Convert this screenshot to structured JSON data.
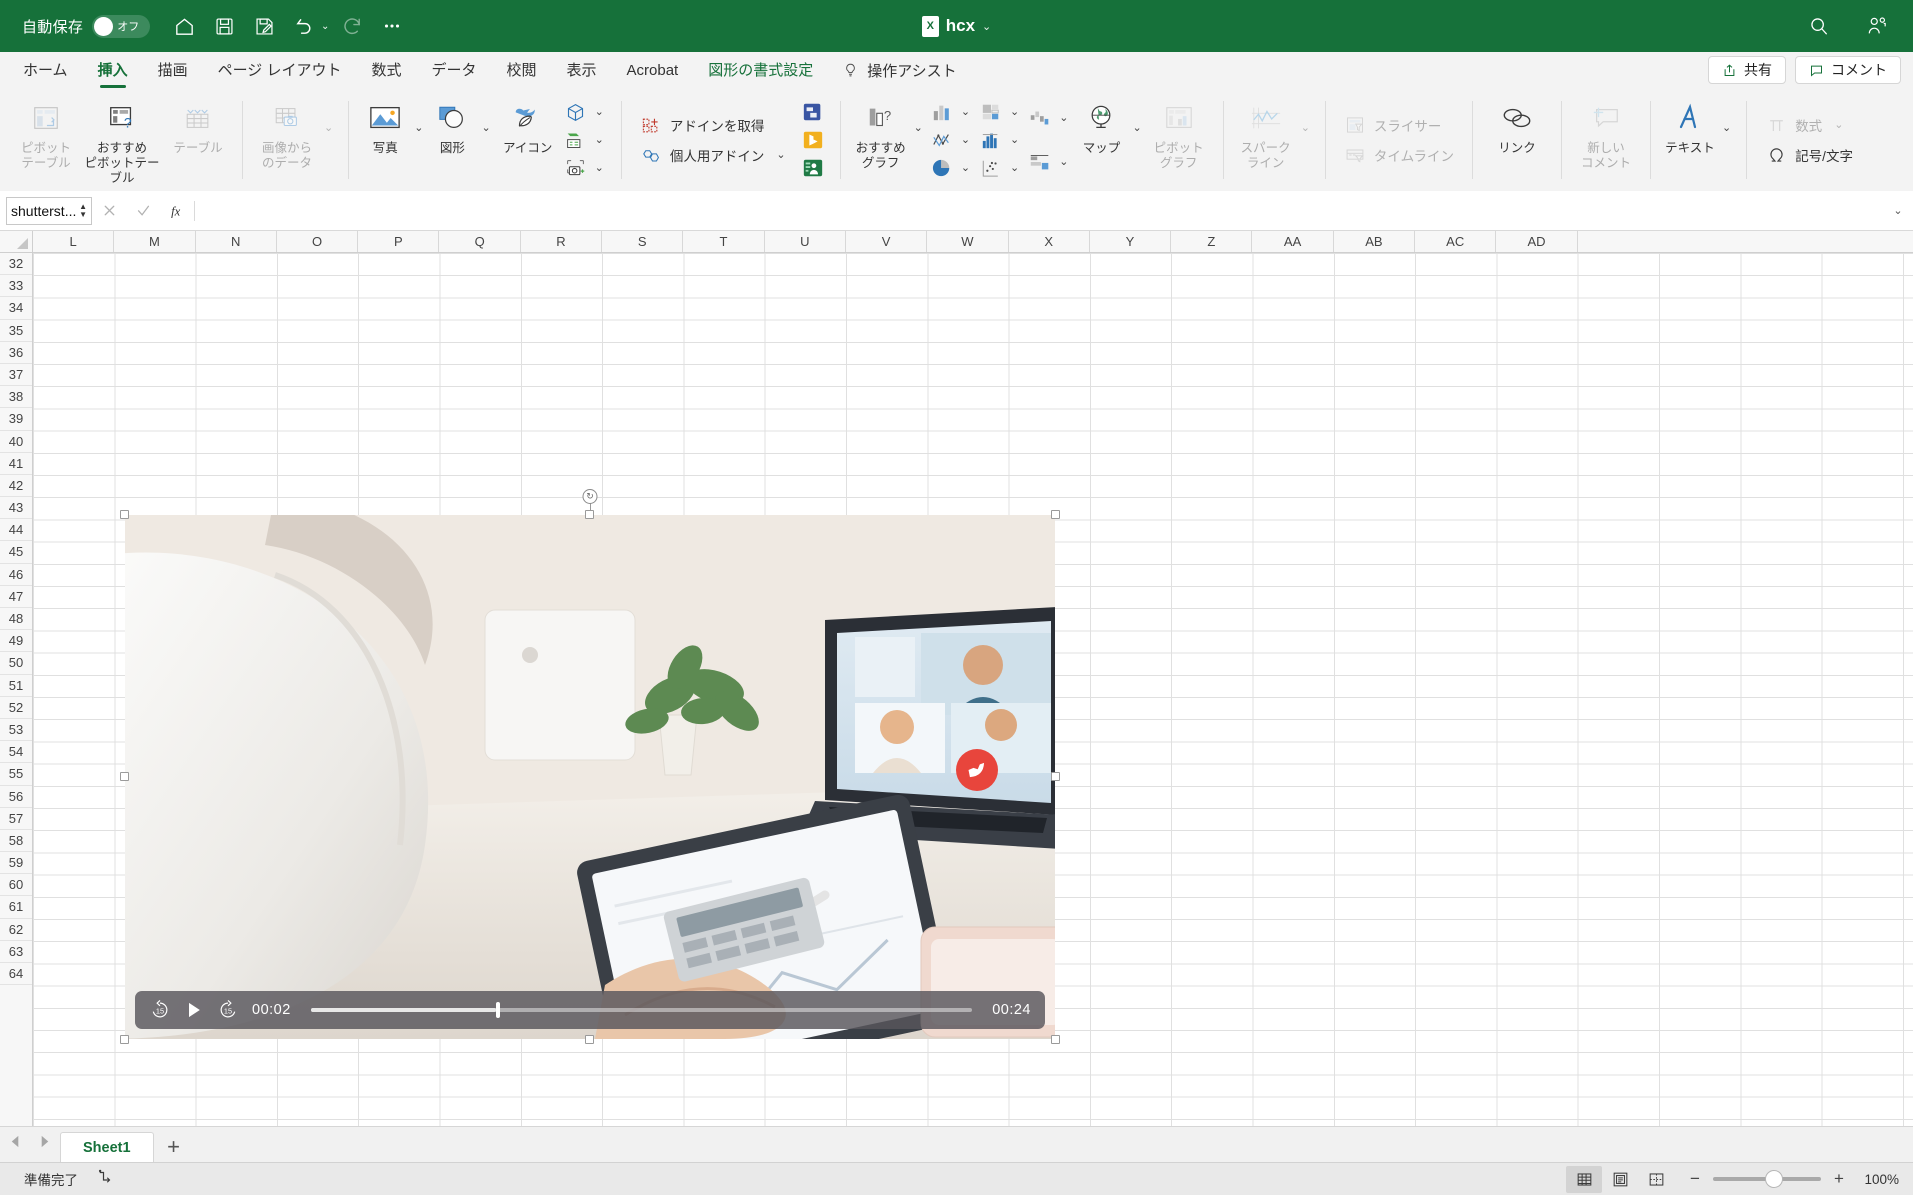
{
  "titlebar": {
    "autosave_label": "自動保存",
    "autosave_state": "オフ",
    "document_title": "hcx",
    "icons": [
      "home-icon",
      "save-icon",
      "save-as-icon",
      "undo-icon",
      "redo-icon",
      "more-icon"
    ],
    "search_icon": "search-icon",
    "account_icon": "account-icon"
  },
  "tabs": {
    "items": [
      {
        "label": "ホーム",
        "state": "normal"
      },
      {
        "label": "挿入",
        "state": "active"
      },
      {
        "label": "描画",
        "state": "normal"
      },
      {
        "label": "ページ レイアウト",
        "state": "normal"
      },
      {
        "label": "数式",
        "state": "normal"
      },
      {
        "label": "データ",
        "state": "normal"
      },
      {
        "label": "校閲",
        "state": "normal"
      },
      {
        "label": "表示",
        "state": "normal"
      },
      {
        "label": "Acrobat",
        "state": "normal"
      },
      {
        "label": "図形の書式設定",
        "state": "contextual"
      }
    ],
    "tell_me": "操作アシスト",
    "share_label": "共有",
    "comments_label": "コメント"
  },
  "ribbon": {
    "groups": [
      {
        "name": "tables",
        "buttons": [
          {
            "label": "ピボット\nテーブル",
            "icon": "pivot-table-icon",
            "disabled": true
          },
          {
            "label": "おすすめ\nピボットテーブル",
            "icon": "recommended-pivot-table-icon",
            "disabled": false
          },
          {
            "label": "テーブル",
            "icon": "table-icon",
            "disabled": true
          }
        ]
      },
      {
        "name": "data-from-picture",
        "buttons": [
          {
            "label": "画像から\nのデータ",
            "icon": "data-from-picture-icon",
            "disabled": true
          }
        ]
      },
      {
        "name": "illustrations",
        "buttons": [
          {
            "label": "写真",
            "icon": "pictures-icon",
            "disabled": false
          },
          {
            "label": "図形",
            "icon": "shapes-icon",
            "disabled": false
          },
          {
            "label": "アイコン",
            "icon": "icons-icon",
            "disabled": false
          }
        ],
        "small_icons": [
          "3d-model-icon",
          "smartart-icon",
          "screenshot-icon"
        ]
      },
      {
        "name": "addins",
        "rows": [
          {
            "label": "アドインを取得",
            "icon": "get-addins-icon",
            "disabled": false
          },
          {
            "label": "個人用アドイン",
            "icon": "my-addins-icon",
            "disabled": false
          }
        ],
        "tiles": [
          "visio-data-visualizer-icon",
          "bing-maps-icon",
          "people-graph-icon"
        ]
      },
      {
        "name": "charts",
        "buttons": [
          {
            "label": "おすすめ\nグラフ",
            "icon": "recommended-charts-icon",
            "disabled": false
          },
          {
            "label": "マップ",
            "icon": "maps-icon",
            "disabled": false
          },
          {
            "label": "ピボット\nグラフ",
            "icon": "pivot-chart-icon",
            "disabled": true
          }
        ],
        "chart_icons": [
          "column-chart-icon",
          "hierarchy-chart-icon",
          "waterfall-chart-icon",
          "line-chart-icon",
          "statistic-chart-icon",
          "scatter-chart-icon",
          "pie-chart-icon",
          "combo-chart-icon"
        ]
      },
      {
        "name": "sparklines",
        "buttons": [
          {
            "label": "スパーク\nライン",
            "icon": "sparkline-icon",
            "disabled": true
          }
        ]
      },
      {
        "name": "filters",
        "rows": [
          {
            "label": "スライサー",
            "icon": "slicer-icon",
            "disabled": true
          },
          {
            "label": "タイムライン",
            "icon": "timeline-icon",
            "disabled": true
          }
        ]
      },
      {
        "name": "links",
        "buttons": [
          {
            "label": "リンク",
            "icon": "link-icon",
            "disabled": false
          }
        ]
      },
      {
        "name": "comments",
        "buttons": [
          {
            "label": "新しい\nコメント",
            "icon": "new-comment-icon",
            "disabled": true
          }
        ]
      },
      {
        "name": "text",
        "buttons": [
          {
            "label": "テキスト",
            "icon": "text-box-icon",
            "disabled": false
          }
        ]
      },
      {
        "name": "symbols",
        "rows": [
          {
            "label": "数式",
            "icon": "equation-icon",
            "disabled": true
          },
          {
            "label": "記号/文字",
            "icon": "symbol-icon",
            "disabled": false
          }
        ]
      }
    ]
  },
  "formula_bar": {
    "name_box_value": "shutterst...",
    "cancel_icon": "cancel-icon",
    "enter_icon": "enter-icon",
    "function_icon": "insert-function-icon",
    "formula_value": "",
    "expand_icon": "expand-formula-bar-icon"
  },
  "grid": {
    "columns": [
      "L",
      "M",
      "N",
      "O",
      "P",
      "Q",
      "R",
      "S",
      "T",
      "U",
      "V",
      "W",
      "X",
      "Y",
      "Z",
      "AA",
      "AB",
      "AC",
      "AD"
    ],
    "rows": [
      32,
      33,
      34,
      35,
      36,
      37,
      38,
      39,
      40,
      41,
      42,
      43,
      44,
      45,
      46,
      47,
      48,
      49,
      50,
      51,
      52,
      53,
      54,
      55,
      56,
      57,
      58,
      59,
      60,
      61,
      62,
      63,
      64
    ]
  },
  "video": {
    "selected": true,
    "rewind_label": "15",
    "forward_label": "15",
    "play_icon": "play-icon",
    "rewind_icon": "rewind-15-icon",
    "forward_icon": "forward-15-icon",
    "current_time": "00:02",
    "total_time": "00:24",
    "progress_percent": 28
  },
  "sheet_tabs": {
    "prev_icon": "prev-sheet-icon",
    "next_icon": "next-sheet-icon",
    "tabs": [
      {
        "label": "Sheet1",
        "active": true
      }
    ],
    "add_label": "+"
  },
  "status_bar": {
    "status_text": "準備完了",
    "accessibility_icon": "accessibility-icon",
    "views": [
      {
        "name": "normal-view",
        "icon": "grid-view-icon",
        "active": true
      },
      {
        "name": "page-layout-view",
        "icon": "page-layout-icon",
        "active": false
      },
      {
        "name": "page-break-view",
        "icon": "page-break-icon",
        "active": false
      }
    ],
    "zoom_out": "−",
    "zoom_in": "+",
    "zoom_level": "100%",
    "zoom_value": 100
  },
  "colors": {
    "brand_green": "#16713A",
    "ribbon_bg": "#f3f3f3",
    "accent_blue": "#2e75b6",
    "status_bg": "#e9e9e9"
  }
}
